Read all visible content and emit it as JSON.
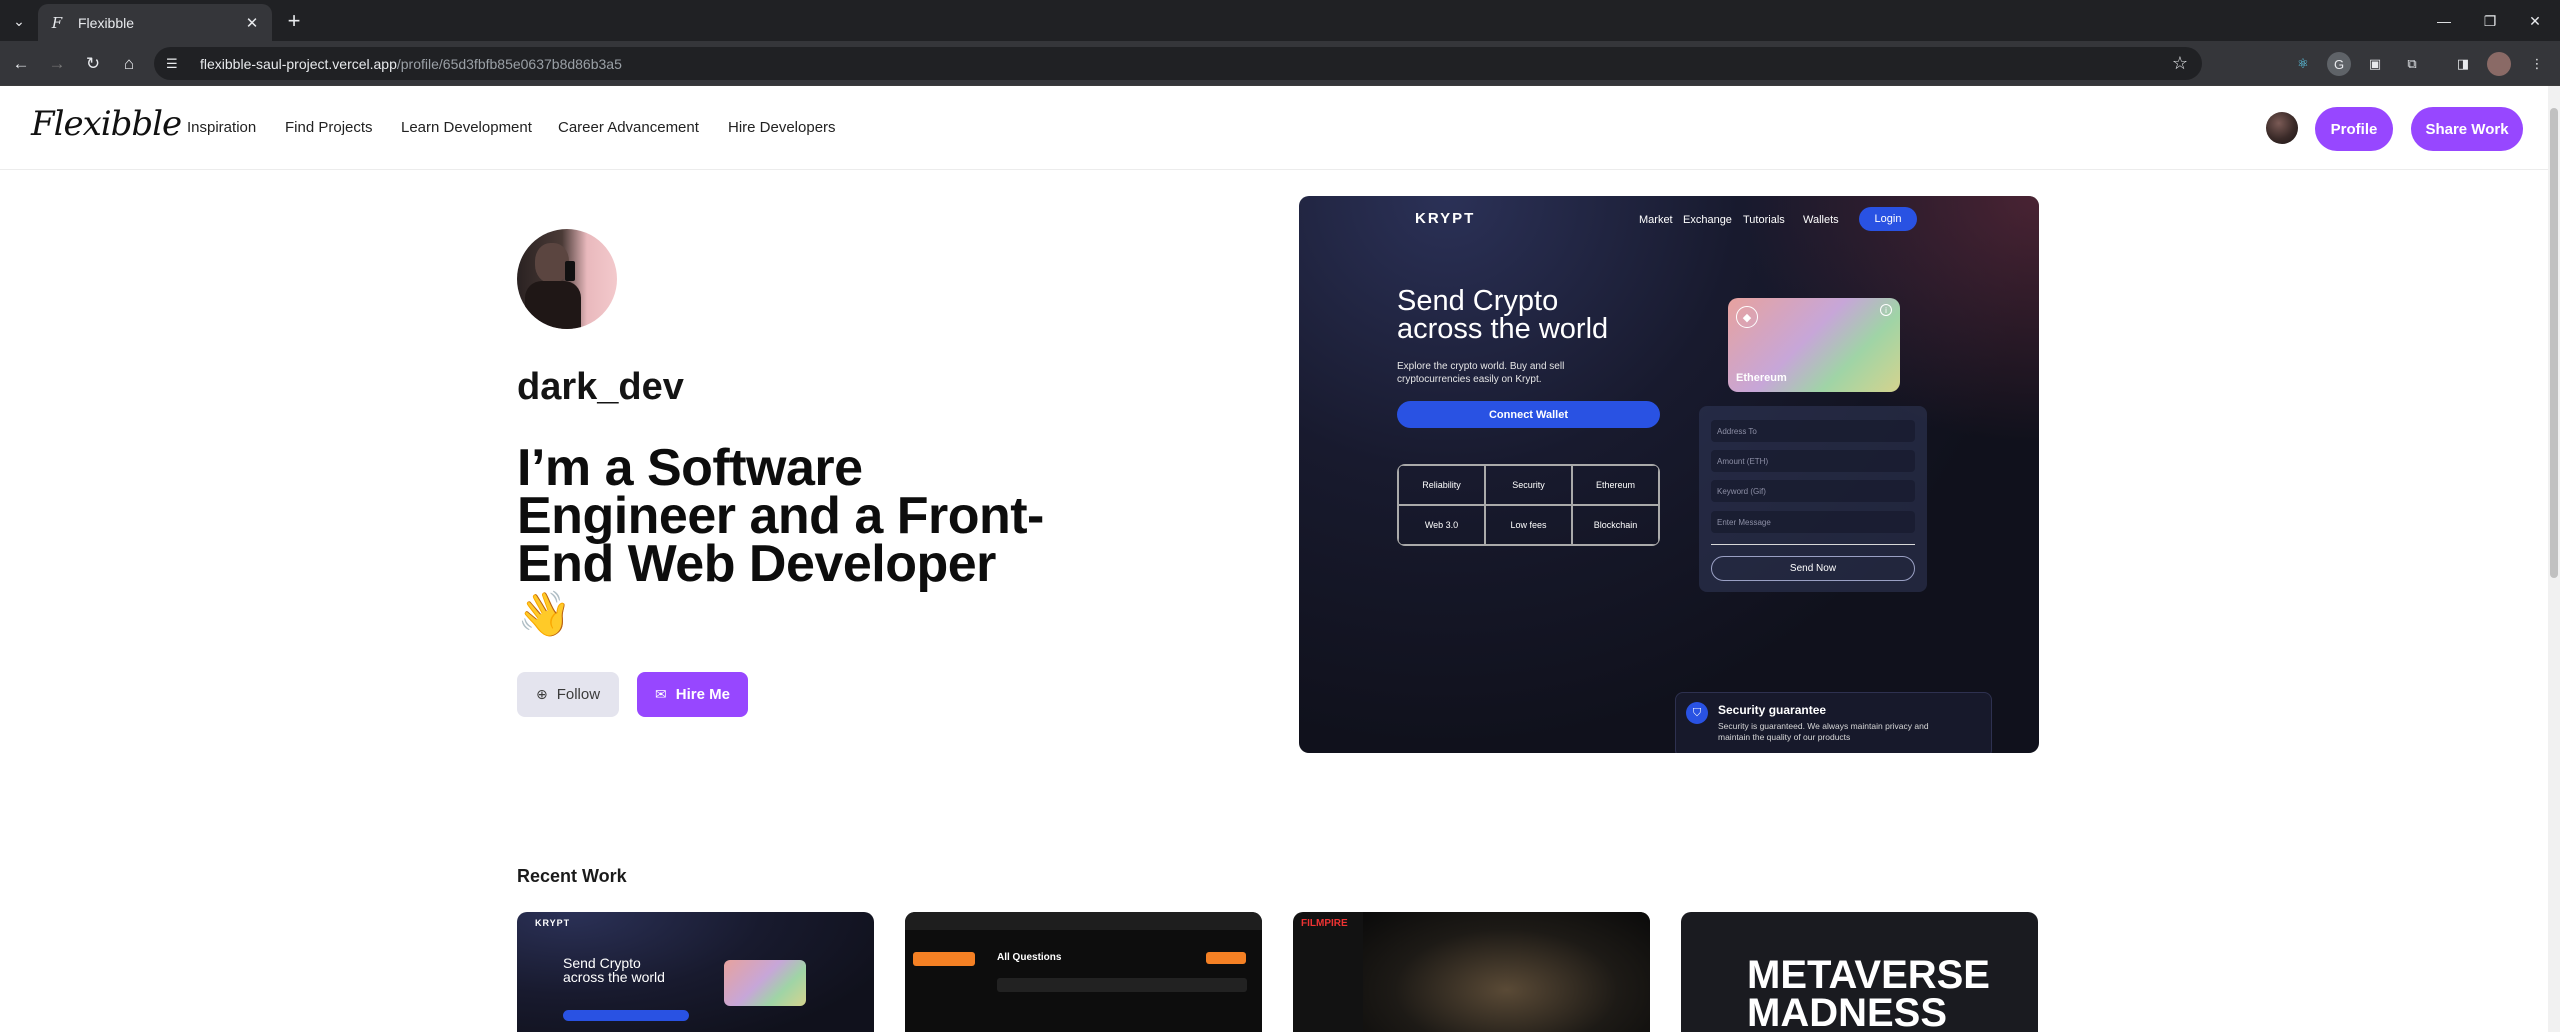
{
  "browser": {
    "tab_title": "Flexibble",
    "url_host": "flexibble-saul-project.vercel.app",
    "url_path": "/profile/65d3fbfb85e0637b8d86b3a5"
  },
  "nav": {
    "logo": "Flexibble",
    "links": [
      "Inspiration",
      "Find Projects",
      "Learn Development",
      "Career Advancement",
      "Hire Developers"
    ],
    "profile_label": "Profile",
    "share_label": "Share Work"
  },
  "profile": {
    "username": "dark_dev",
    "headline": "I’m a Software Engineer and a Front-End Web Developer",
    "wave": "👋",
    "follow_label": "Follow",
    "hire_label": "Hire Me"
  },
  "preview": {
    "logo": "KRYPT",
    "nav": [
      "Market",
      "Exchange",
      "Tutorials",
      "Wallets"
    ],
    "login": "Login",
    "hero_line1": "Send Crypto",
    "hero_line2": "across the world",
    "subtitle": "Explore the crypto world. Buy and sell cryptocurrencies easily on Krypt.",
    "connect": "Connect Wallet",
    "features": [
      "Reliability",
      "Security",
      "Ethereum",
      "Web 3.0",
      "Low fees",
      "Blockchain"
    ],
    "card_label": "Ethereum",
    "fields": [
      "Address To",
      "Amount (ETH)",
      "Keyword (Gif)",
      "Enter Message"
    ],
    "send": "Send Now",
    "security_title": "Security guarantee",
    "security_text": "Security is guaranteed. We always maintain privacy and maintain the quality of our products"
  },
  "recent": {
    "title": "Recent Work",
    "items": [
      {
        "hero_line1": "Send Crypto",
        "hero_line2": "across the world"
      },
      {
        "title": "All Questions"
      },
      {
        "title": "FILMPIRE"
      },
      {
        "title": "METAVERSE",
        "line2": "MADNESS"
      }
    ]
  }
}
